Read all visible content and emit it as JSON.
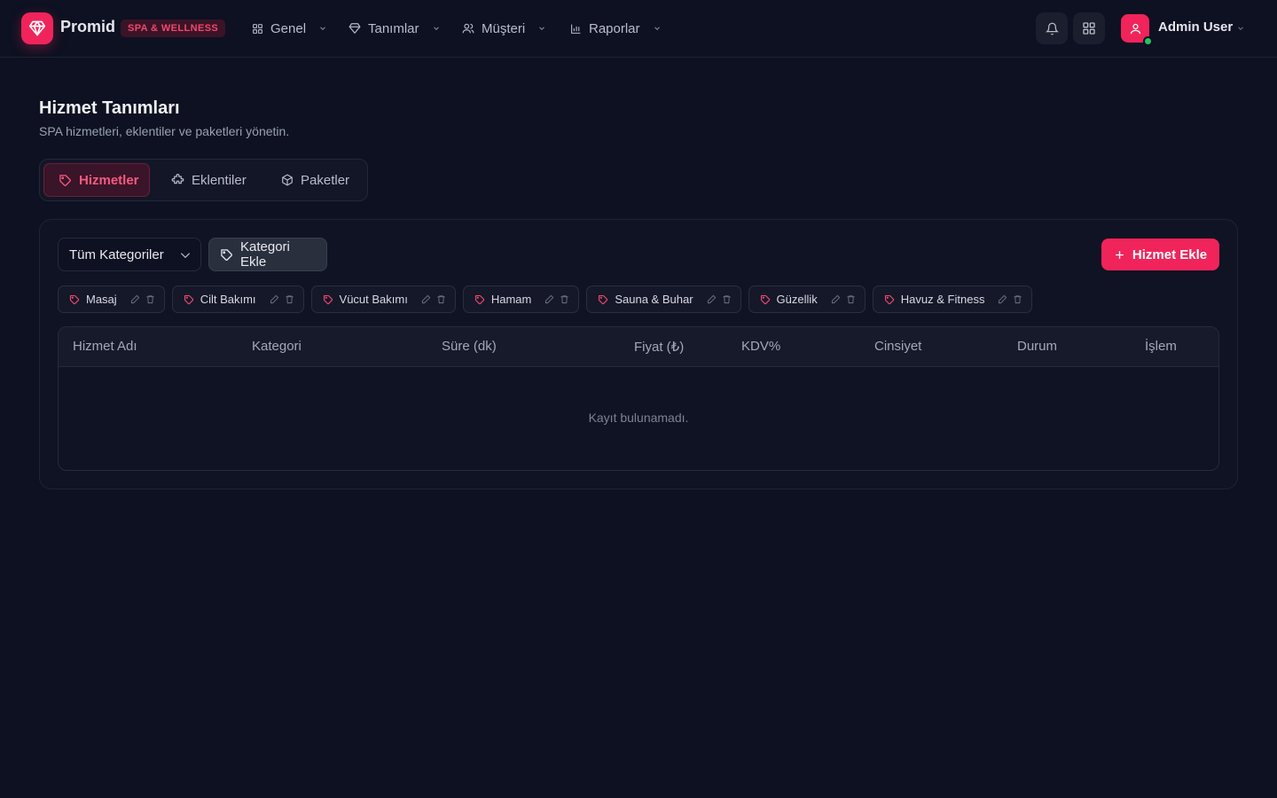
{
  "app": {
    "brand": "Promid",
    "badge": "SPA & WELLNESS"
  },
  "nav": {
    "items": [
      {
        "label": "Genel",
        "icon": "grid-icon"
      },
      {
        "label": "Tanımlar",
        "icon": "diamond-icon"
      },
      {
        "label": "Müşteri",
        "icon": "users-icon"
      },
      {
        "label": "Raporlar",
        "icon": "bar-chart-icon"
      }
    ]
  },
  "user": {
    "name": "Admin User",
    "status": "online"
  },
  "page": {
    "title": "Hizmet Tanımları",
    "subtitle": "SPA hizmetleri, eklentiler ve paketleri yönetin."
  },
  "tabs": [
    {
      "label": "Hizmetler",
      "icon": "tag-icon",
      "active": true
    },
    {
      "label": "Eklentiler",
      "icon": "puzzle-icon",
      "active": false
    },
    {
      "label": "Paketler",
      "icon": "package-icon",
      "active": false
    }
  ],
  "toolbar": {
    "category_select": "Tüm Kategoriler",
    "add_category_label": "Kategori Ekle",
    "add_service_label": "Hizmet Ekle"
  },
  "categories": [
    "Masaj",
    "Cilt Bakımı",
    "Vücut Bakımı",
    "Hamam",
    "Sauna & Buhar",
    "Güzellik",
    "Havuz & Fitness"
  ],
  "table": {
    "columns": [
      "Hizmet Adı",
      "Kategori",
      "Süre (dk)",
      "Fiyat (₺)",
      "KDV%",
      "Cinsiyet",
      "Durum",
      "İşlem"
    ],
    "rows": [],
    "empty_message": "Kayıt bulunamadı."
  },
  "colors": {
    "accent": "#f0245a",
    "background": "#0d1121",
    "online": "#22c55e"
  }
}
